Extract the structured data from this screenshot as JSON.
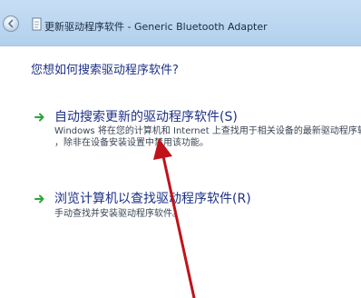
{
  "window": {
    "title": "更新驱动程序软件 - Generic Bluetooth Adapter"
  },
  "main": {
    "question": "您想如何搜索驱动程序软件?",
    "options": [
      {
        "title": "自动搜索更新的驱动程序软件(S)",
        "desc_line1": "Windows 将在您的计算机和 Internet 上查找用于相关设备的最新驱动程序软件",
        "desc_line2": "，除非在设备安装设置中禁用该功能。"
      },
      {
        "title": "浏览计算机以查找驱动程序软件(R)",
        "desc_line1": "手动查找并安装驱动程序软件。"
      }
    ]
  },
  "icons": {
    "back": "back-arrow-icon",
    "document": "document-icon",
    "option_arrow": "green-arrow-icon",
    "annotation": "red-annotation-arrow"
  },
  "colors": {
    "link_blue": "#1e3287",
    "option_arrow_green": "#2aa63a",
    "annotation_red": "#c0121a"
  }
}
